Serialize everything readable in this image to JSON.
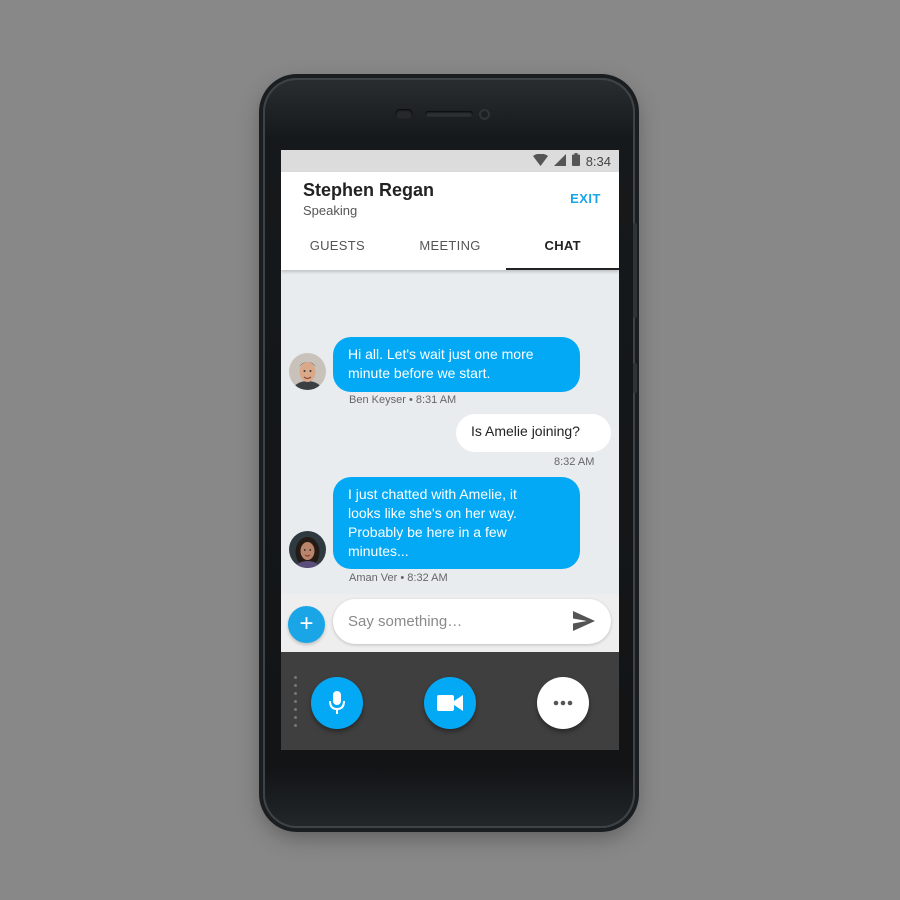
{
  "status_bar": {
    "time": "8:34",
    "icons": [
      "wifi-icon",
      "signal-icon",
      "battery-icon"
    ]
  },
  "header": {
    "title": "Stephen Regan",
    "subtitle": "Speaking",
    "exit_label": "EXIT"
  },
  "tabs": [
    {
      "label": "GUESTS",
      "active": false
    },
    {
      "label": "MEETING",
      "active": false
    },
    {
      "label": "CHAT",
      "active": true
    }
  ],
  "messages": [
    {
      "direction": "incoming",
      "text": "Hi all. Let's wait just one more minute before we start.",
      "lines": [
        "Hi all. Let's wait just one more",
        "minute before we start."
      ],
      "sender": "Ben Keyser",
      "time": "8:31 AM"
    },
    {
      "direction": "outgoing",
      "text": "Is Amelie joining?",
      "time": "8:32 AM"
    },
    {
      "direction": "incoming",
      "text": "I just chatted with Amelie, it looks like she's on her way. Probably be here in a few minutes...",
      "lines": [
        "I just chatted with Amelie, it",
        "looks like she's on her way.",
        "Probably be here in a few",
        "minutes..."
      ],
      "sender": "Aman Ver",
      "time": "8:32 AM"
    }
  ],
  "composer": {
    "placeholder": "Say something…",
    "value": "",
    "add_icon": "plus-icon",
    "send_icon": "send-icon"
  },
  "call_controls": [
    {
      "name": "microphone",
      "icon": "microphone-icon",
      "color": "#03a9f4"
    },
    {
      "name": "video",
      "icon": "video-camera-icon",
      "color": "#03a9f4"
    },
    {
      "name": "more",
      "icon": "more-horizontal-icon",
      "color": "#ffffff"
    }
  ],
  "colors": {
    "accent": "#03a9f4",
    "chat_background": "#e9ecef",
    "call_bar": "#3f3f3f"
  }
}
